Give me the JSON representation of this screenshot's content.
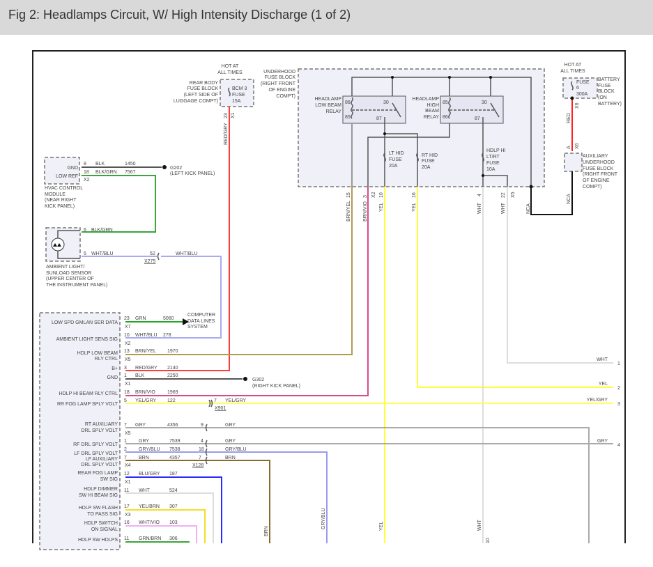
{
  "title": "Fig 2: Headlamps Circuit, W/ High Intensity Discharge (1 of 2)",
  "rear_fuse": {
    "hot": [
      "HOT AT",
      "ALL TIMES"
    ],
    "name": [
      "REAR BODY",
      "FUSE BLOCK",
      "(LEFT SIDE OF",
      "LUGGAGE COMPT)"
    ],
    "fuse": [
      "BCM 3",
      "FUSE",
      "15A"
    ],
    "pin": "23",
    "conn": "X1",
    "wire": "RED/GRY"
  },
  "hvac": {
    "name": [
      "HVAC CONTROL",
      "MODULE",
      "(NEAR RIGHT",
      "KICK PANEL)"
    ],
    "pins": [
      {
        "label": "GND",
        "pin": "8",
        "color": "BLK",
        "circuit": "1450"
      },
      {
        "label": "LOW REF",
        "pin": "18",
        "color": "BLK/GRN",
        "circuit": "7567"
      }
    ],
    "conn": "X2",
    "ground": "G202",
    "ground_loc": "(LEFT KICK PANEL)"
  },
  "sensor": {
    "name": [
      "AMBIENT LIGHT/",
      "SUNLOAD SENSOR",
      "(UPPER CENTER OF",
      "THE INSTRUMENT PANEL)"
    ],
    "pins": [
      {
        "pin": "6",
        "color": "BLK/GRN"
      },
      {
        "pin": "5",
        "color": "WHT/BLU"
      }
    ],
    "inline_pin": "52",
    "inline_conn": "X275",
    "inline_color": "WHT/BLU"
  },
  "underhood": {
    "name": [
      "UNDERHOOD",
      "FUSE BLOCK",
      "(RIGHT FRONT",
      "OF ENGINE",
      "COMPT)"
    ],
    "low_relay": [
      "HEADLAMP",
      "LOW BEAM",
      "RELAY"
    ],
    "low_pins": [
      "86",
      "85",
      "30",
      "87"
    ],
    "high_relay": [
      "HEADLAMP",
      "HIGH",
      "BEAM",
      "RELAY"
    ],
    "high_pins": [
      "85",
      "86",
      "30",
      "87"
    ],
    "lt_fuse": [
      "LT HID",
      "FUSE",
      "20A"
    ],
    "rt_fuse": [
      "RT HID",
      "FUSE",
      "20A"
    ],
    "hi_fuse": [
      "HDLP HI",
      "LT/RT",
      "FUSE",
      "10A"
    ],
    "outputs": [
      {
        "pin": "15",
        "color": "BRN/YEL"
      },
      {
        "pin": "3",
        "color": "BRN/VIO"
      },
      {
        "pin": "10",
        "color": "YEL"
      },
      {
        "pin": "16",
        "color": "YEL"
      },
      {
        "pin": "4",
        "color": "WHT"
      },
      {
        "pin": "22",
        "color": "WHT"
      }
    ],
    "conns": [
      "X2",
      "X5"
    ],
    "nca": "NCA"
  },
  "battery": {
    "hot": [
      "HOT AT",
      "ALL TIMES"
    ],
    "fuse": [
      "FUSE",
      "6",
      "300A"
    ],
    "name": [
      "BATTERY",
      "FUSE",
      "BLOCK",
      "(ON",
      "BATTERY)"
    ],
    "conn": "X6",
    "wire": "RED",
    "aux_pin": "A",
    "aux_conn": "X6",
    "aux_name": [
      "AUXILIARY",
      "UNDERHOOD",
      "FUSE BLOCK",
      "(RIGHT FRONT",
      "OF ENGINE",
      "COMPT)"
    ],
    "wire2": "NCA"
  },
  "computer": [
    "COMPUTER",
    "DATA LINES",
    "SYSTEM"
  ],
  "g302": [
    "G302",
    "(RIGHT KICK PANEL)"
  ],
  "bcm": [
    {
      "label": [
        "LOW SPD GMLAN SER DATA"
      ],
      "pin": "23",
      "color": "GRN",
      "circuit": "5060",
      "conn": "X7"
    },
    {
      "label": [
        "AMBIENT LIGHT SENS SIG"
      ],
      "pin": "10",
      "color": "WHT/BLU",
      "circuit": "278",
      "conn": "X2"
    },
    {
      "label": [
        "HDLP LOW BEAM",
        "RLY CTRL"
      ],
      "pin": "13",
      "color": "BRN/YEL",
      "circuit": "1970",
      "conn": "X5"
    },
    {
      "label": [
        "B+"
      ],
      "pin": "3",
      "color": "RED/GRY",
      "circuit": "2140"
    },
    {
      "label": [
        "GND"
      ],
      "pin": "1",
      "color": "BLK",
      "circuit": "2250",
      "conn": "X1"
    },
    {
      "label": [
        "HDLP HI BEAM RLY CTRL"
      ],
      "pin": "18",
      "color": "BRN/VIO",
      "circuit": "1969"
    },
    {
      "label": [
        "RR FOG LAMP SPLY VOLT"
      ],
      "pin": "5",
      "color": "YEL/GRY",
      "circuit": "122"
    },
    {
      "label": [
        "RT AUXILIARY",
        "DRL SPLY VOLT"
      ],
      "pin": "7",
      "color": "GRY",
      "circuit": "4356",
      "conn": "X5"
    },
    {
      "label": [
        "RF DRL SPLY VOLT"
      ],
      "pin": "1",
      "color": "GRY",
      "circuit": "7539"
    },
    {
      "label": [
        "LF DRL SPLY VOLT"
      ],
      "pin": "2",
      "color": "GRY/BLU",
      "circuit": "7538"
    },
    {
      "label": [
        "LF AUXILIARY",
        "DRL SPLY VOLT"
      ],
      "pin": "7",
      "color": "BRN",
      "circuit": "4357",
      "conn": "X4"
    },
    {
      "label": [
        "REAR FOG LAMP",
        "SW SIG"
      ],
      "pin": "12",
      "color": "BLU/GRY",
      "circuit": "187",
      "conn": "X1"
    },
    {
      "label": [
        "HDLP DIMMER",
        "SW HI BEAM SIG"
      ],
      "pin": "11",
      "color": "WHT",
      "circuit": "524"
    },
    {
      "label": [
        "HDLP SW FLASH",
        "TO PASS SIG"
      ],
      "pin": "17",
      "color": "YEL/BRN",
      "circuit": "307",
      "conn": "X3"
    },
    {
      "label": [
        "HDLP SWITCH",
        "ON SIGNAL"
      ],
      "pin": "16",
      "color": "WHT/VIO",
      "circuit": "103"
    },
    {
      "label": [
        "HDLP SW HDLPS"
      ],
      "pin": "11",
      "color": "GRN/BRN",
      "circuit": "306"
    }
  ],
  "inline": {
    "x901": {
      "pin": "7",
      "conn": "X901",
      "color": "YEL/GRY"
    },
    "rt_aux": {
      "pin": "9",
      "color": "GRY"
    },
    "rf_drl": {
      "pin": "4",
      "color": "GRY"
    },
    "lf_drl": {
      "pin": "18",
      "color": "GRY/BLU"
    },
    "x128": {
      "pin": "7",
      "conn": "X128",
      "color": "BRN"
    }
  },
  "right": [
    {
      "color": "WHT",
      "pin": "1"
    },
    {
      "color": "YEL",
      "pin": "2"
    },
    {
      "color": "YEL/GRY",
      "pin": "3"
    },
    {
      "color": "GRY",
      "pin": "4"
    }
  ],
  "bottom": {
    "grybl": "GRY/BLU",
    "brn": "BRN",
    "yel": "YEL",
    "wht": "WHT",
    "wht_pin": "10"
  },
  "colors": {
    "red": "#ff3b3b",
    "grn": "#3aa53a",
    "blu": "#9a9af0",
    "brnyel": "#b39a4a",
    "brnvio": "#d94a8a",
    "yel": "#ffff33",
    "gry": "#aaaaaa",
    "wht": "#dddddd",
    "blk": "#222222"
  }
}
